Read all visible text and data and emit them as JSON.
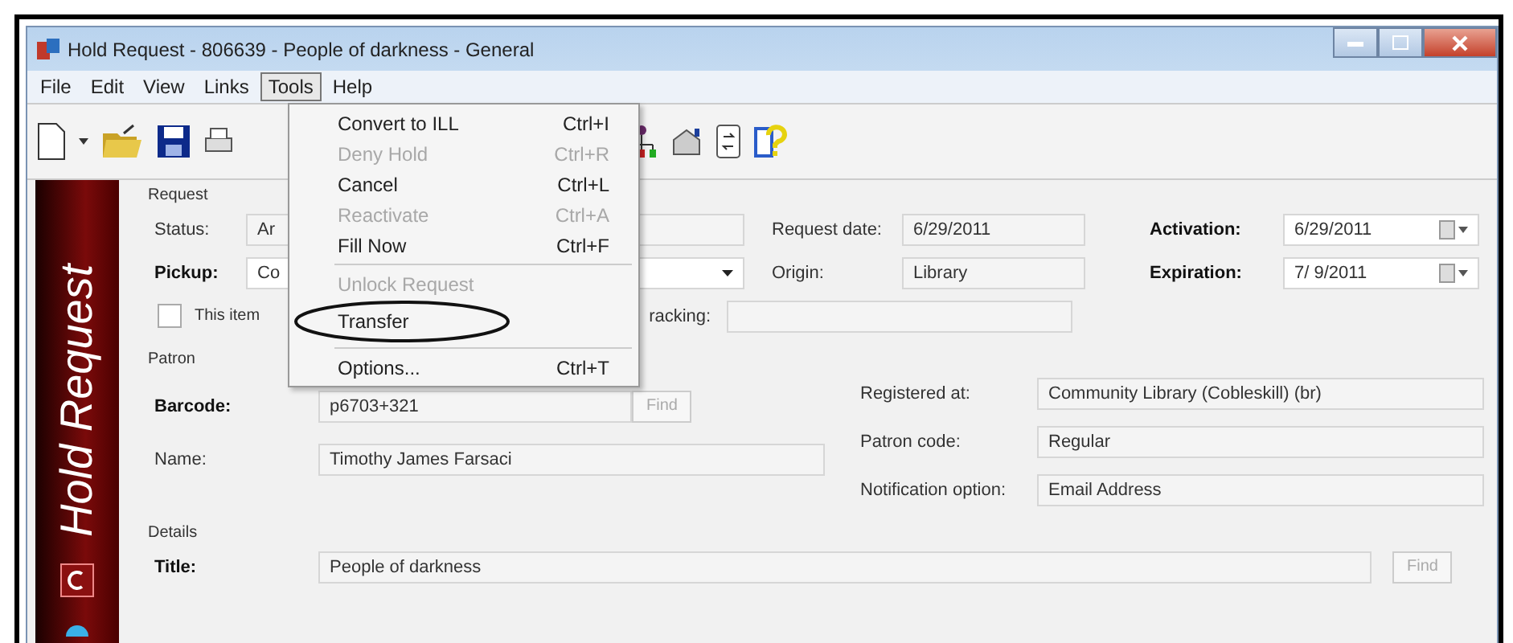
{
  "window": {
    "title": "Hold Request - 806639 - People of darkness - General"
  },
  "menu_bar": [
    {
      "label": "File",
      "selected": false
    },
    {
      "label": "Edit",
      "selected": false
    },
    {
      "label": "View",
      "selected": false
    },
    {
      "label": "Links",
      "selected": false
    },
    {
      "label": "Tools",
      "selected": true
    },
    {
      "label": "Help",
      "selected": false
    }
  ],
  "tools_menu": [
    {
      "kind": "item",
      "label": "Convert to ILL",
      "shortcut": "Ctrl+I",
      "disabled": false,
      "circled": false
    },
    {
      "kind": "item",
      "label": "Deny Hold",
      "shortcut": "Ctrl+R",
      "disabled": true,
      "circled": false
    },
    {
      "kind": "item",
      "label": "Cancel",
      "shortcut": "Ctrl+L",
      "disabled": false,
      "circled": false
    },
    {
      "kind": "item",
      "label": "Reactivate",
      "shortcut": "Ctrl+A",
      "disabled": true,
      "circled": false
    },
    {
      "kind": "item",
      "label": "Fill Now",
      "shortcut": "Ctrl+F",
      "disabled": false,
      "circled": false
    },
    {
      "kind": "separator"
    },
    {
      "kind": "item",
      "label": "Unlock Request",
      "disabled": true,
      "circled": false
    },
    {
      "kind": "item",
      "label": "Transfer",
      "disabled": false,
      "circled": true
    },
    {
      "kind": "separator"
    },
    {
      "kind": "item",
      "label": "Options...",
      "shortcut": "Ctrl+T",
      "disabled": false,
      "circled": false
    }
  ],
  "sidebar": {
    "title": "Hold Request"
  },
  "request": {
    "heading": "Request",
    "rows": [
      [
        {
          "kind": "text",
          "label": "Status:",
          "value": "Ar",
          "bold": false
        },
        {
          "kind": "text",
          "label": "Request date:",
          "value": "6/29/2011",
          "bold": false
        },
        {
          "kind": "date",
          "label": "Activation:",
          "value": "6/29/2011",
          "bold": true
        }
      ],
      [
        {
          "kind": "dropdown",
          "label": "Pickup:",
          "value": "Co",
          "bold": true
        },
        {
          "kind": "text",
          "label": "Origin:",
          "value": "Library",
          "bold": false
        },
        {
          "kind": "date",
          "label": "Expiration:",
          "value": "7/ 9/2011",
          "bold": true
        }
      ]
    ],
    "checkbox": {
      "label": "This item",
      "checked": false
    },
    "tracking": {
      "label": "racking:"
    }
  },
  "patron": {
    "heading": "Patron",
    "barcode": {
      "label": "Barcode:",
      "value": "p6703+321",
      "button": "Find",
      "disabled": true
    },
    "name": {
      "label": "Name:",
      "value": "Timothy James Farsaci"
    },
    "info": [
      {
        "label": "Registered at:",
        "value": "Community Library (Cobleskill) (br)"
      },
      {
        "label": "Patron code:",
        "value": "Regular"
      },
      {
        "label": "Notification option:",
        "value": "Email Address"
      }
    ]
  },
  "details": {
    "heading": "Details",
    "title": {
      "label": "Title:",
      "value": "People of darkness",
      "button": "Find",
      "disabled": true
    }
  }
}
